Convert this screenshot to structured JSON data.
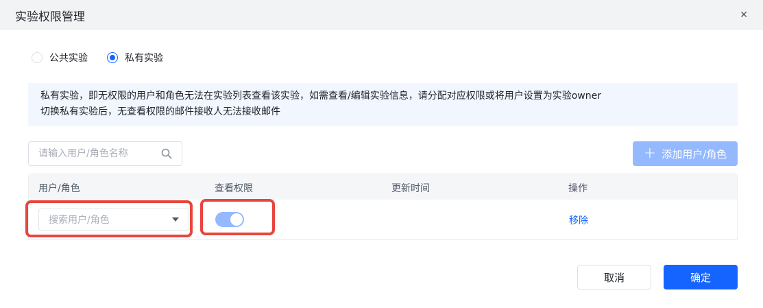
{
  "dialog": {
    "title": "实验权限管理",
    "close_icon": "✕"
  },
  "visibility": {
    "options": [
      {
        "label": "公共实验",
        "selected": false
      },
      {
        "label": "私有实验",
        "selected": true
      }
    ]
  },
  "notice": {
    "line1": "私有实验，即无权限的用户和角色无法在实验列表查看该实验，如需查看/编辑实验信息，请分配对应权限或将用户设置为实验owner",
    "line2": "切换私有实验后，无查看权限的邮件接收人无法接收邮件"
  },
  "search": {
    "placeholder": "请输入用户/角色名称",
    "icon": "search-icon"
  },
  "add_button": {
    "icon": "+",
    "label": "添加用户/角色"
  },
  "table": {
    "columns": [
      "用户/角色",
      "查看权限",
      "更新时间",
      "操作"
    ],
    "rows": [
      {
        "user_placeholder": "搜索用户/角色",
        "view_permission": true,
        "updated_at": "",
        "action": "移除"
      }
    ]
  },
  "footer": {
    "cancel_label": "取消",
    "confirm_label": "确定"
  },
  "colors": {
    "primary": "#1664ff",
    "primary_light": "#94b9ff",
    "highlight": "#e8453c",
    "notice_bg": "#f2f6ff",
    "header_bg": "#f2f3f5"
  }
}
